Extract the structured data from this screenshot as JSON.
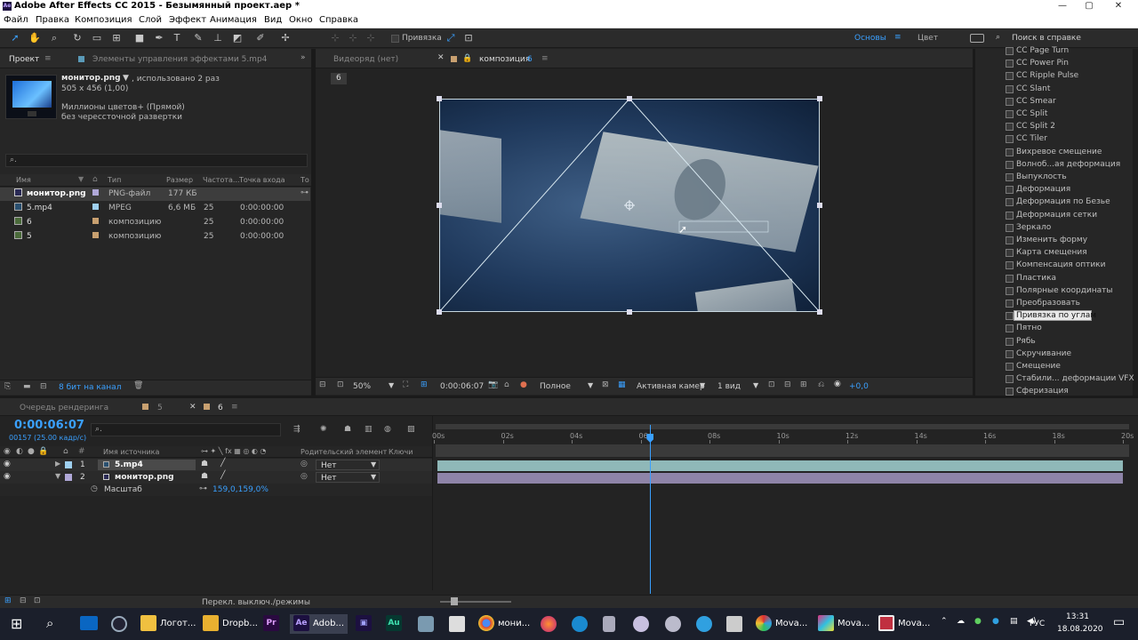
{
  "window": {
    "title": "Adobe After Effects CC 2015 - Безымянный проект.aep *",
    "app_badge": "Ae"
  },
  "menu": [
    "Файл",
    "Правка",
    "Композиция",
    "Слой",
    "Эффект",
    "Анимация",
    "Вид",
    "Окно",
    "Справка"
  ],
  "toolbar": {
    "snap_label": "Привязка",
    "workspace_active": "Основы",
    "workspace_other": "Цвет",
    "search_placeholder": "Поиск в справке"
  },
  "project_panel": {
    "tab_project": "Проект",
    "tab_effects": "Элементы управления эффектами 5.mp4",
    "preview_name": "монитор.png",
    "used": ", использовано 2 раз",
    "dimensions": "505 x 456 (1,00)",
    "color": "Миллионы цветов+ (Прямой)",
    "scan": "без черессточной развертки",
    "search_placeholder": "",
    "columns": {
      "name": "Имя",
      "type": "Тип",
      "size": "Размер",
      "rate": "Частота...",
      "in": "Точка входа",
      "extra": "То"
    },
    "items": [
      {
        "name": "монитор.png",
        "type": "PNG-файл",
        "size": "177 КБ",
        "rate": "",
        "in": "",
        "color": "#b0a8d8"
      },
      {
        "name": "5.mp4",
        "type": "MPEG",
        "size": "6,6 МБ",
        "rate": "25",
        "in": "0:00:00:00",
        "color": "#9fd0f0"
      },
      {
        "name": "6",
        "type": "композицию",
        "size": "",
        "rate": "25",
        "in": "0:00:00:00",
        "color": "#c8a070"
      },
      {
        "name": "5",
        "type": "композицию",
        "size": "",
        "rate": "25",
        "in": "0:00:00:00",
        "color": "#c8a070"
      }
    ],
    "bitdepth": "8 бит на канал"
  },
  "viewer": {
    "tab_footage": "Видеоряд (нет)",
    "tab_comp_prefix": "композиция",
    "tab_comp_number": "6",
    "comp_label": "6",
    "zoom": "50%",
    "timecode": "0:00:06:07",
    "quality": "Полное",
    "camera": "Активная камер",
    "views": "1 вид",
    "exposure": "+0,0"
  },
  "effects_list": [
    "CC Page Turn",
    "CC Power Pin",
    "CC Ripple Pulse",
    "CC Slant",
    "CC Smear",
    "CC Split",
    "CC Split 2",
    "CC Tiler",
    "Вихревое смещение",
    "Волноб...ая деформация",
    "Выпуклость",
    "Деформация",
    "Деформация по Безье",
    "Деформация сетки",
    "Зеркало",
    "Изменить форму",
    "Карта смещения",
    "Компенсация оптики",
    "Пластика",
    "Полярные координаты",
    "Преобразовать",
    "Привязка по углам",
    "Пятно",
    "Рябь",
    "Скручивание",
    "Смещение",
    "Стабили... деформации VFX",
    "Сферизация"
  ],
  "effects_selected_index": 21,
  "timeline": {
    "tab_render": "Очередь рендеринга",
    "tab_comp5": "5",
    "tab_comp6": "6",
    "timecode": "0:00:06:07",
    "frames": "00157 (25.00 кадр/с)",
    "col_source": "Имя источника",
    "col_parent": "Родительский элемент",
    "col_keys": "Ключи",
    "layers": [
      {
        "num": "1",
        "name": "5.mp4",
        "parent": "Нет",
        "color": "#9fd0f0"
      },
      {
        "num": "2",
        "name": "монитор.png",
        "parent": "Нет",
        "color": "#b0a8d8"
      }
    ],
    "property_name": "Масштаб",
    "property_value": "159,0,159,0%",
    "ruler": [
      "00s",
      "02s",
      "04s",
      "06s",
      "08s",
      "10s",
      "12s",
      "14s",
      "16s",
      "18s",
      "20s"
    ],
    "playhead_seconds": 6.28,
    "duration_seconds": 20,
    "footer_toggle": "Перекл. выключ./режимы"
  },
  "taskbar": {
    "apps": [
      {
        "label": "Логот...",
        "icon": "folder-icon"
      },
      {
        "label": "Dropb...",
        "icon": "dropbox-icon"
      },
      {
        "label": "",
        "icon": "Pr"
      },
      {
        "label": "Adob...",
        "icon": "Ae"
      },
      {
        "label": "",
        "icon": "media-encoder-icon"
      },
      {
        "label": "",
        "icon": "Au"
      },
      {
        "label": "мони...",
        "icon": "chrome-icon"
      },
      {
        "label": "Mova...",
        "icon": "movavi-icon"
      },
      {
        "label": "Mova...",
        "icon": "movavi-icon"
      },
      {
        "label": "Mova...",
        "icon": "movavi-icon"
      }
    ],
    "lang": "РУС",
    "time": "13:31",
    "date": "18.08.2020"
  }
}
